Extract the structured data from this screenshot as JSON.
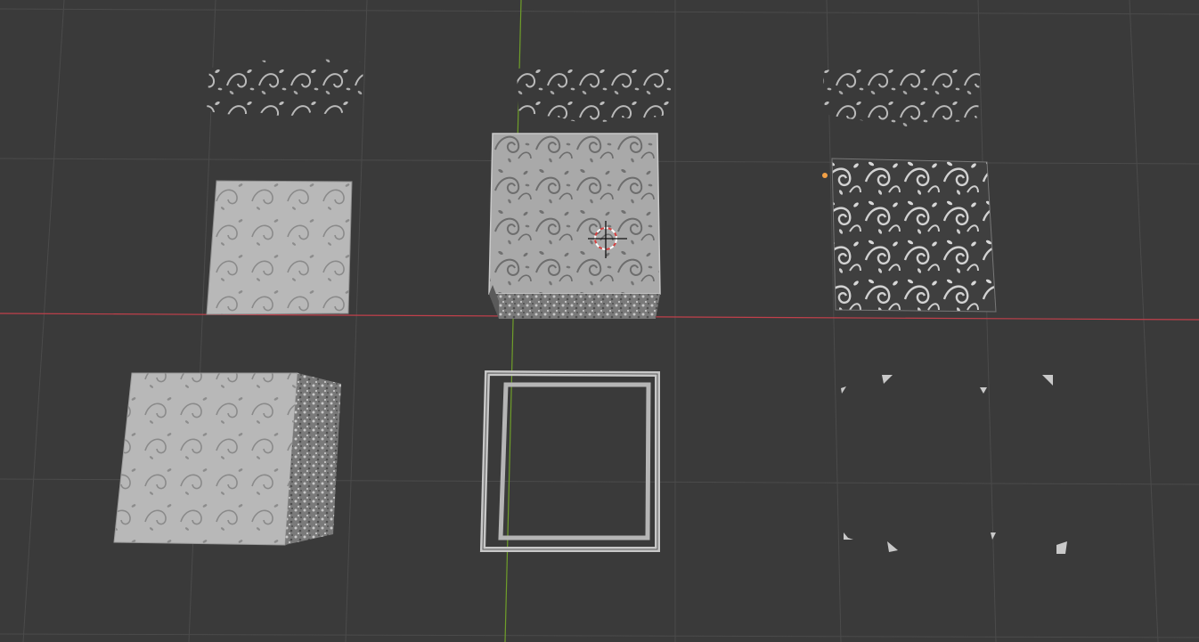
{
  "viewport": {
    "background_color": "#3a3a3a",
    "grid_color": "#4b4b4b",
    "x_axis_color": "#c1404b",
    "y_axis_color": "#6f9e2a"
  },
  "scene_objects": [
    {
      "id": "floral-strip-left",
      "kind": "ornament-strip"
    },
    {
      "id": "floral-strip-center",
      "kind": "ornament-strip"
    },
    {
      "id": "floral-strip-right",
      "kind": "ornament-strip"
    },
    {
      "id": "embossed-plane",
      "kind": "textured-plane"
    },
    {
      "id": "selected-cube",
      "kind": "textured-cube"
    },
    {
      "id": "floral-cutout-panel",
      "kind": "pierced-panel"
    },
    {
      "id": "embossed-cube",
      "kind": "textured-cube"
    },
    {
      "id": "hollow-frame",
      "kind": "frame"
    },
    {
      "id": "corner-brackets",
      "kind": "corner-pieces"
    }
  ],
  "icons": {
    "cursor": "3d-cursor-icon",
    "origin": "object-origin-icon"
  }
}
